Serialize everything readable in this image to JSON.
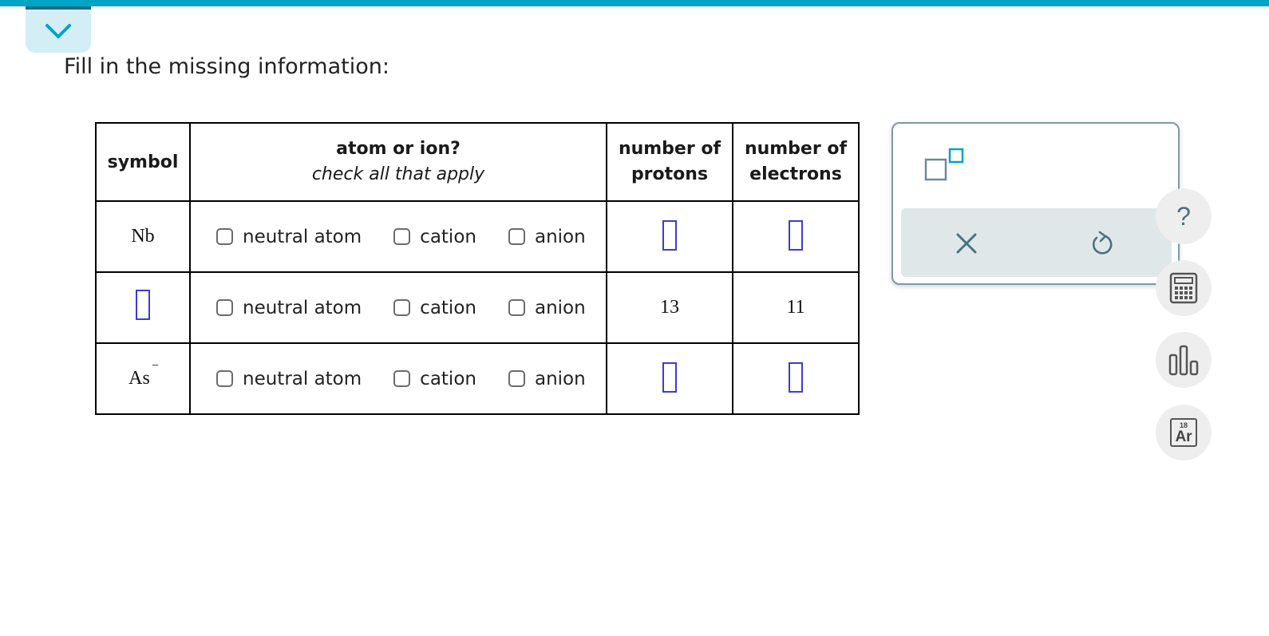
{
  "prompt": "Fill in the missing information:",
  "table": {
    "headers": {
      "symbol": "symbol",
      "atom_or_ion": "atom or ion?",
      "atom_or_ion_sub": "check all that apply",
      "protons_line1": "number of",
      "protons_line2": "protons",
      "electrons_line1": "number of",
      "electrons_line2": "electrons"
    },
    "choice_labels": [
      "neutral atom",
      "cation",
      "anion"
    ],
    "rows": [
      {
        "symbol": "Nb",
        "symbol_sup": "",
        "protons": "",
        "electrons": ""
      },
      {
        "symbol": "",
        "symbol_sup": "",
        "protons": "13",
        "electrons": "11"
      },
      {
        "symbol": "As",
        "symbol_sup": "−",
        "protons": "",
        "electrons": ""
      }
    ]
  },
  "side_tools": {
    "help": "?",
    "periodic_number": "18",
    "periodic_symbol": "Ar"
  },
  "colors": {
    "accent": "#00a4c4",
    "answer_box": "#3b3bd6",
    "tool_icon": "#4a7180"
  }
}
